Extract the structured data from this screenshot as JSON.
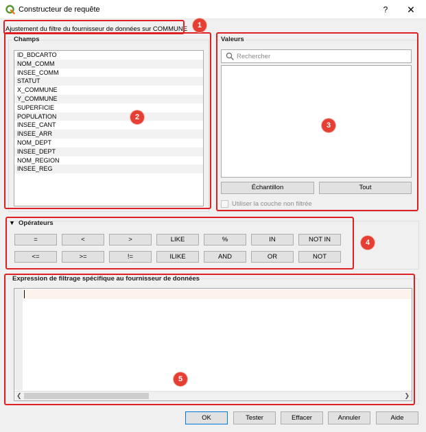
{
  "window": {
    "title": "Constructeur de requête",
    "help_label": "?",
    "close_label": "✕"
  },
  "filter_label": "Ajustement du filtre du fournisseur de données sur COMMUNE",
  "fields": {
    "title": "Champs",
    "items": [
      "ID_BDCARTO",
      "NOM_COMM",
      "INSEE_COMM",
      "STATUT",
      "X_COMMUNE",
      "Y_COMMUNE",
      "SUPERFICIE",
      "POPULATION",
      "INSEE_CANT",
      "INSEE_ARR",
      "NOM_DEPT",
      "INSEE_DEPT",
      "NOM_REGION",
      "INSEE_REG"
    ]
  },
  "values": {
    "title": "Valeurs",
    "search_placeholder": "Rechercher",
    "sample_label": "Échantillon",
    "all_label": "Tout",
    "unfiltered_label": "Utiliser la couche non filtrée"
  },
  "operators": {
    "title": "Opérateurs",
    "toggle": "▼",
    "row1": [
      "=",
      "<",
      ">",
      "LIKE",
      "%",
      "IN",
      "NOT IN"
    ],
    "row2": [
      "<=",
      ">=",
      "!=",
      "ILIKE",
      "AND",
      "OR",
      "NOT"
    ]
  },
  "expression": {
    "title": "Expression de filtrage spécifique au fournisseur de données"
  },
  "buttons": {
    "ok": "OK",
    "test": "Tester",
    "clear": "Effacer",
    "cancel": "Annuler",
    "help": "Aide"
  },
  "annotations": [
    "1",
    "2",
    "3",
    "4",
    "5"
  ],
  "colors": {
    "annotation": "#e02020",
    "accent": "#0078d7"
  }
}
